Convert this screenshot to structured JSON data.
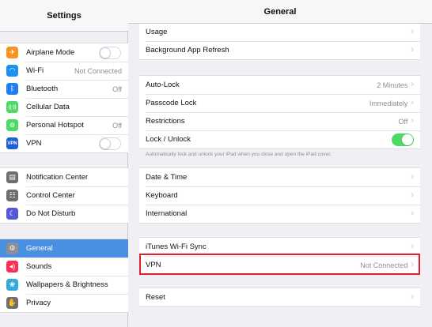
{
  "sidebar": {
    "title": "Settings",
    "groups": [
      [
        {
          "label": "Airplane Mode",
          "icon": "airplane-icon",
          "icon_color": "#f7931e",
          "glyph": "✈",
          "control": "toggle-off"
        },
        {
          "label": "Wi-Fi",
          "icon": "wifi-icon",
          "icon_color": "#1e90f0",
          "glyph": "◠",
          "detail": "Not Connected"
        },
        {
          "label": "Bluetooth",
          "icon": "bluetooth-icon",
          "icon_color": "#1e7ff0",
          "glyph": "ᛒ",
          "detail": "Off"
        },
        {
          "label": "Cellular Data",
          "icon": "cellular-icon",
          "icon_color": "#4cd964",
          "glyph": "((·))"
        },
        {
          "label": "Personal Hotspot",
          "icon": "hotspot-icon",
          "icon_color": "#4cd964",
          "glyph": "⊚",
          "detail": "Off"
        },
        {
          "label": "VPN",
          "icon": "vpn-icon",
          "icon_color": "#1e5fd8",
          "glyph": "VPN",
          "control": "toggle-off"
        }
      ],
      [
        {
          "label": "Notification Center",
          "icon": "notification-center-icon",
          "icon_color": "#6d6d72",
          "glyph": "▤"
        },
        {
          "label": "Control Center",
          "icon": "control-center-icon",
          "icon_color": "#6d6d72",
          "glyph": "☷"
        },
        {
          "label": "Do Not Disturb",
          "icon": "moon-icon",
          "icon_color": "#5856d6",
          "glyph": "☾"
        }
      ],
      [
        {
          "label": "General",
          "icon": "gear-icon",
          "icon_color": "#8e8e93",
          "glyph": "⚙",
          "selected": true
        },
        {
          "label": "Sounds",
          "icon": "speaker-icon",
          "icon_color": "#ff2d55",
          "glyph": "◂)"
        },
        {
          "label": "Wallpapers & Brightness",
          "icon": "wallpaper-icon",
          "icon_color": "#34aadc",
          "glyph": "❀"
        },
        {
          "label": "Privacy",
          "icon": "hand-icon",
          "icon_color": "#6d6d72",
          "glyph": "✋"
        }
      ]
    ]
  },
  "main": {
    "title": "General",
    "groups": [
      [
        {
          "label": "Usage",
          "chevron": true
        },
        {
          "label": "Background App Refresh",
          "chevron": true
        }
      ],
      [
        {
          "label": "Auto-Lock",
          "detail": "2 Minutes",
          "chevron": true
        },
        {
          "label": "Passcode Lock",
          "detail": "Immediately",
          "chevron": true
        },
        {
          "label": "Restrictions",
          "detail": "Off",
          "chevron": true
        },
        {
          "label": "Lock / Unlock",
          "control": "toggle-on"
        }
      ],
      [
        {
          "label": "Date & Time",
          "chevron": true
        },
        {
          "label": "Keyboard",
          "chevron": true
        },
        {
          "label": "International",
          "chevron": true
        }
      ],
      [
        {
          "label": "iTunes Wi-Fi Sync",
          "chevron": true
        },
        {
          "label": "VPN",
          "detail": "Not Connected",
          "chevron": true
        }
      ],
      [
        {
          "label": "Reset",
          "chevron": true
        }
      ]
    ],
    "footnote": "Automatically lock and unlock your iPad when you close and open the iPad cover.",
    "chevron_glyph": "›"
  }
}
